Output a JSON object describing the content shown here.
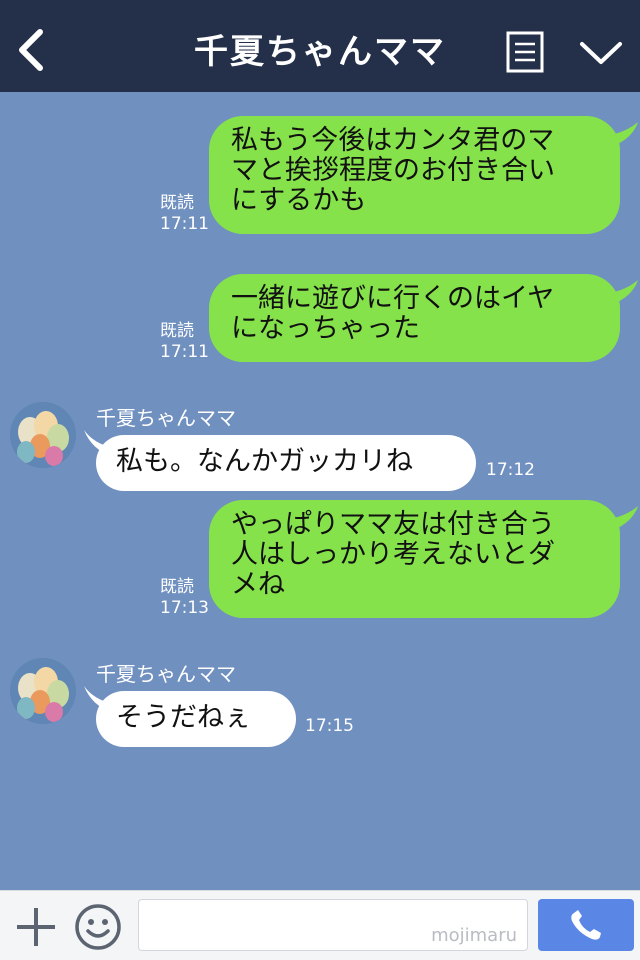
{
  "header": {
    "title": "千夏ちゃんママ",
    "back_icon": "chevron-left-icon",
    "menu_icon": "list-icon",
    "collapse_icon": "chevron-down-icon"
  },
  "messages": [
    {
      "direction": "out",
      "lines": [
        "私もう今後はカンタ君のマ",
        "マと挨拶程度のお付き合い",
        "にするかも"
      ],
      "read": "既読",
      "time": "17:11"
    },
    {
      "direction": "out",
      "lines": [
        "一緒に遊びに行くのはイヤ",
        "になっちゃった"
      ],
      "read": "既読",
      "time": "17:11"
    },
    {
      "direction": "in",
      "sender": "千夏ちゃんママ",
      "lines": [
        "私も。なんかガッカリね"
      ],
      "time": "17:12"
    },
    {
      "direction": "out",
      "lines": [
        "やっぱりママ友は付き合う",
        "人はしっかり考えないとダ",
        "メね"
      ],
      "read": "既読",
      "time": "17:13"
    },
    {
      "direction": "in",
      "sender": "千夏ちゃんママ",
      "lines": [
        "そうだねぇ"
      ],
      "time": "17:15"
    }
  ],
  "footer": {
    "add_icon": "plus-icon",
    "sticker_icon": "smile-icon",
    "input_value": "",
    "watermark": "mojimaru",
    "call_icon": "phone-icon"
  },
  "colors": {
    "header_bg": "#243049",
    "chat_bg": "#7090c0",
    "outgoing_bubble": "#86e24a",
    "incoming_bubble": "#ffffff",
    "call_button": "#5a86e6"
  }
}
